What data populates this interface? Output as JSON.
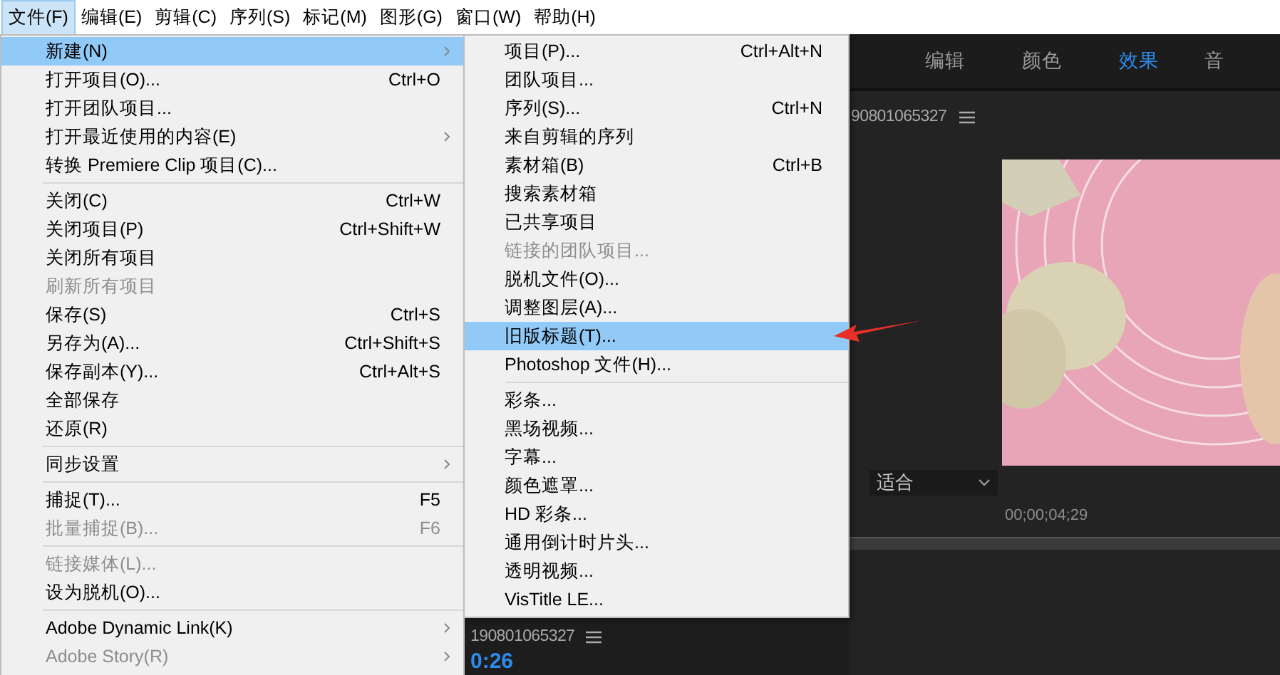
{
  "menu_bar": [
    {
      "label": "文件(F)",
      "selected": true
    },
    {
      "label": "编辑(E)",
      "selected": false
    },
    {
      "label": "剪辑(C)",
      "selected": false
    },
    {
      "label": "序列(S)",
      "selected": false
    },
    {
      "label": "标记(M)",
      "selected": false
    },
    {
      "label": "图形(G)",
      "selected": false
    },
    {
      "label": "窗口(W)",
      "selected": false
    },
    {
      "label": "帮助(H)",
      "selected": false
    }
  ],
  "file_menu": [
    [
      {
        "label": "新建(N)",
        "submenu": true,
        "disabled": false,
        "selected": true
      },
      {
        "label": "打开项目(O)...",
        "shortcut": "Ctrl+O",
        "submenu": false,
        "disabled": false,
        "selected": false
      },
      {
        "label": "打开团队项目...",
        "submenu": false,
        "disabled": false,
        "selected": false
      },
      {
        "label": "打开最近使用的内容(E)",
        "submenu": true,
        "disabled": false,
        "selected": false
      },
      {
        "label": "转换 Premiere Clip 项目(C)...",
        "submenu": false,
        "disabled": false,
        "selected": false
      }
    ],
    [
      {
        "label": "关闭(C)",
        "shortcut": "Ctrl+W",
        "submenu": false,
        "disabled": false,
        "selected": false
      },
      {
        "label": "关闭项目(P)",
        "shortcut": "Ctrl+Shift+W",
        "submenu": false,
        "disabled": false,
        "selected": false
      },
      {
        "label": "关闭所有项目",
        "submenu": false,
        "disabled": false,
        "selected": false
      },
      {
        "label": "刷新所有项目",
        "submenu": false,
        "disabled": true,
        "selected": false
      },
      {
        "label": "保存(S)",
        "shortcut": "Ctrl+S",
        "submenu": false,
        "disabled": false,
        "selected": false
      },
      {
        "label": "另存为(A)...",
        "shortcut": "Ctrl+Shift+S",
        "submenu": false,
        "disabled": false,
        "selected": false
      },
      {
        "label": "保存副本(Y)...",
        "shortcut": "Ctrl+Alt+S",
        "submenu": false,
        "disabled": false,
        "selected": false
      },
      {
        "label": "全部保存",
        "submenu": false,
        "disabled": false,
        "selected": false
      },
      {
        "label": "还原(R)",
        "submenu": false,
        "disabled": false,
        "selected": false
      }
    ],
    [
      {
        "label": "同步设置",
        "submenu": true,
        "disabled": false,
        "selected": false
      }
    ],
    [
      {
        "label": "捕捉(T)...",
        "shortcut": "F5",
        "submenu": false,
        "disabled": false,
        "selected": false
      },
      {
        "label": "批量捕捉(B)...",
        "shortcut": "F6",
        "submenu": false,
        "disabled": true,
        "selected": false
      }
    ],
    [
      {
        "label": "链接媒体(L)...",
        "submenu": false,
        "disabled": true,
        "selected": false
      },
      {
        "label": "设为脱机(O)...",
        "submenu": false,
        "disabled": false,
        "selected": false
      }
    ],
    [
      {
        "label": "Adobe Dynamic Link(K)",
        "submenu": true,
        "disabled": false,
        "selected": false
      },
      {
        "label": "Adobe Story(R)",
        "submenu": true,
        "disabled": true,
        "selected": false
      }
    ]
  ],
  "new_submenu": [
    [
      {
        "label": "项目(P)...",
        "shortcut": "Ctrl+Alt+N",
        "disabled": false,
        "selected": false
      },
      {
        "label": "团队项目...",
        "disabled": false,
        "selected": false
      },
      {
        "label": "序列(S)...",
        "shortcut": "Ctrl+N",
        "disabled": false,
        "selected": false
      },
      {
        "label": "来自剪辑的序列",
        "disabled": false,
        "selected": false
      },
      {
        "label": "素材箱(B)",
        "shortcut": "Ctrl+B",
        "disabled": false,
        "selected": false
      },
      {
        "label": "搜索素材箱",
        "disabled": false,
        "selected": false
      },
      {
        "label": "已共享项目",
        "disabled": false,
        "selected": false
      },
      {
        "label": "链接的团队项目...",
        "disabled": true,
        "selected": false
      },
      {
        "label": "脱机文件(O)...",
        "disabled": false,
        "selected": false
      },
      {
        "label": "调整图层(A)...",
        "disabled": false,
        "selected": false
      },
      {
        "label": "旧版标题(T)...",
        "disabled": false,
        "selected": true
      },
      {
        "label": "Photoshop 文件(H)...",
        "disabled": false,
        "selected": false
      }
    ],
    [
      {
        "label": "彩条...",
        "disabled": false,
        "selected": false
      },
      {
        "label": "黑场视频...",
        "disabled": false,
        "selected": false
      },
      {
        "label": "字幕...",
        "disabled": false,
        "selected": false
      },
      {
        "label": "颜色遮罩...",
        "disabled": false,
        "selected": false
      },
      {
        "label": "HD 彩条...",
        "disabled": false,
        "selected": false
      },
      {
        "label": "通用倒计时片头...",
        "disabled": false,
        "selected": false
      },
      {
        "label": "透明视频...",
        "disabled": false,
        "selected": false
      },
      {
        "label": "VisTitle LE...",
        "disabled": false,
        "selected": false
      }
    ]
  ],
  "workspace_tabs": [
    {
      "label": "编辑",
      "selected": false
    },
    {
      "label": "颜色",
      "selected": false
    },
    {
      "label": "效果",
      "selected": true
    },
    {
      "label": "音",
      "selected": false
    }
  ],
  "program_monitor": {
    "sequence_name": "90801065327",
    "fit_dropdown": "适合",
    "timecode": "00;00;04;29"
  },
  "timeline": {
    "sequence_name": "190801065327",
    "timecode": "0:26"
  }
}
